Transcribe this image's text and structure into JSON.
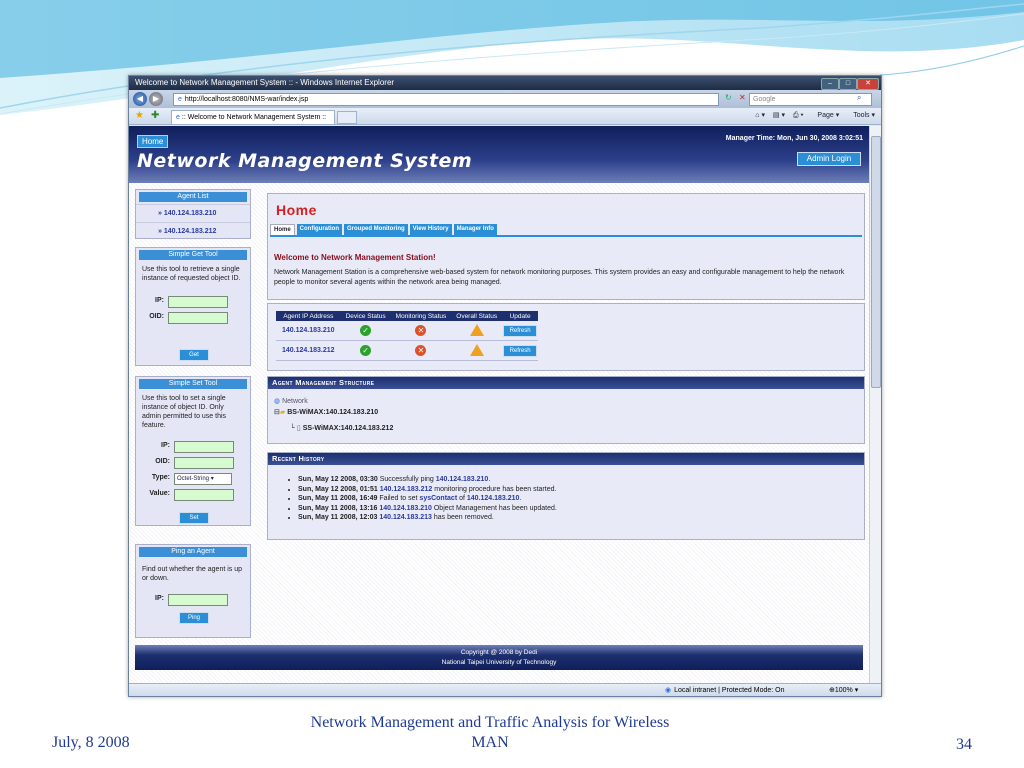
{
  "slide": {
    "footer_date": "July, 8 2008",
    "footer_title": "Network Management and Traffic Analysis for Wireless MAN",
    "page_number": "34"
  },
  "browser": {
    "window_title": "Welcome to Network Management System :: - Windows Internet Explorer",
    "address": "http://localhost:8080/NMS-war/index.jsp",
    "search_placeholder": "Google",
    "tab_title": ":: Welcome to Network Management System ::",
    "cmd_page": "Page",
    "cmd_tools": "Tools",
    "status_zone": "Local intranet | Protected Mode: On",
    "zoom": "100%"
  },
  "header": {
    "home_tab": "Home",
    "site_title": "Network Management System",
    "manager_time": "Manager Time: Mon, Jun 30, 2008 3:02:51",
    "admin_login": "Admin Login"
  },
  "sidebar": {
    "agent_list": {
      "title": "Agent List",
      "items": [
        "» 140.124.183.210",
        "» 140.124.183.212"
      ]
    },
    "get_tool": {
      "title": "Simple Get Tool",
      "description": "Use this tool to retrieve a single instance of requested object ID.",
      "ip_label": "IP:",
      "oid_label": "OID:",
      "button": "Get"
    },
    "set_tool": {
      "title": "Simple Set Tool",
      "description": "Use this tool to set a single instance of object ID. Only admin permitted to use this feature.",
      "ip_label": "IP:",
      "oid_label": "OID:",
      "type_label": "Type:",
      "type_value": "Octet-String",
      "value_label": "Value:",
      "button": "Set"
    },
    "ping": {
      "title": "Ping an Agent",
      "description": "Find out whether the agent is up or down.",
      "ip_label": "IP:",
      "button": "Ping"
    }
  },
  "main": {
    "heading": "Home",
    "tabs": [
      "Home",
      "Configuration",
      "Grouped Monitoring",
      "View History",
      "Manager Info"
    ],
    "welcome_title": "Welcome to Network Management Station!",
    "welcome_text": "Network Management Station is a comprehensive web-based system for network monitoring purposes. This system provides an easy and configurable management to help the network people to monitor several agents within the network area being managed.",
    "status_table": {
      "headers": [
        "Agent IP Address",
        "Device Status",
        "Monitoring Status",
        "Overall Status",
        "Update"
      ],
      "rows": [
        {
          "ip": "140.124.183.210",
          "device": "ok",
          "monitoring": "error",
          "overall": "warning",
          "update": "Refresh"
        },
        {
          "ip": "140.124.183.212",
          "device": "ok",
          "monitoring": "error",
          "overall": "warning",
          "update": "Refresh"
        }
      ]
    },
    "structure": {
      "title": "Agent Management Structure",
      "root": "Network",
      "bs": "BS-WiMAX:140.124.183.210",
      "ss": "SS-WiMAX:140.124.183.212"
    },
    "history": {
      "title": "Recent History",
      "items": [
        {
          "date": "Sun, May 12 2008, 03:30",
          "pre": " Successfully ping ",
          "link": "140.124.183.210",
          "post": ".",
          "link2": "",
          "post2": ""
        },
        {
          "date": "Sun, May 12 2008, 01:51",
          "pre": " ",
          "link": "140.124.183.212",
          "post": " monitoring procedure has been started.",
          "link2": "",
          "post2": ""
        },
        {
          "date": "Sun, May 11 2008, 16:49",
          "pre": " Failed to set ",
          "link": "sysContact",
          "post": " of ",
          "link2": "140.124.183.210",
          "post2": "."
        },
        {
          "date": "Sun, May 11 2008, 13:16",
          "pre": " ",
          "link": "140.124.183.210",
          "post": " Object Management has been updated.",
          "link2": "",
          "post2": ""
        },
        {
          "date": "Sun, May 11 2008, 12:03",
          "pre": " ",
          "link": "140.124.183.213",
          "post": " has been removed.",
          "link2": "",
          "post2": ""
        }
      ]
    }
  },
  "footer": {
    "copyright": "Copyright @ 2008 by Dedi",
    "institution": "National Taipei University of Technology"
  }
}
